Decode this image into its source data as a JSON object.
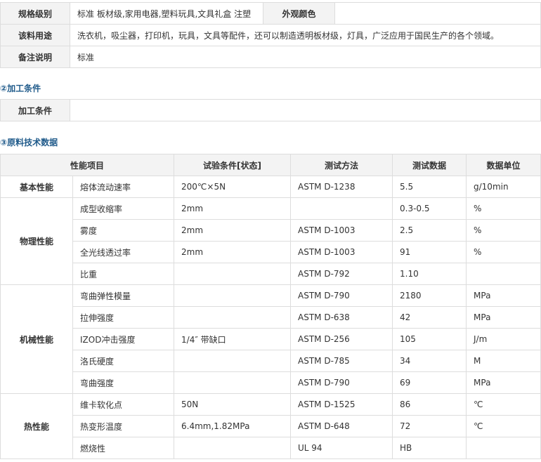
{
  "spec": {
    "rows": [
      {
        "label": "规格级别",
        "value": "标准 板材级,家用电器,塑料玩具,文具礼盒 注塑",
        "label2": "外观颜色",
        "value2": ""
      },
      {
        "label": "该料用途",
        "value": "洗衣机，吸尘器，打印机，玩具，文具等配件，还可以制造透明板材级，灯具，广泛应用于国民生产的各个领域。"
      },
      {
        "label": "备注说明",
        "value": "标准"
      }
    ]
  },
  "processing": {
    "title": "②加工条件",
    "label": "加工条件",
    "value": ""
  },
  "technical": {
    "title": "③原料技术数据",
    "headers": [
      "性能项目",
      "试验条件[状态]",
      "测试方法",
      "测试数据",
      "数据单位"
    ],
    "groups": [
      {
        "name": "基本性能",
        "rows": [
          {
            "item": "熔体流动速率",
            "cond": "200℃×5N",
            "method": "ASTM D-1238",
            "value": "5.5",
            "unit": "g/10min"
          }
        ]
      },
      {
        "name": "物理性能",
        "rows": [
          {
            "item": "成型收缩率",
            "cond": "2mm",
            "method": "",
            "value": "0.3-0.5",
            "unit": "%"
          },
          {
            "item": "雾度",
            "cond": "2mm",
            "method": "ASTM D-1003",
            "value": "2.5",
            "unit": "%"
          },
          {
            "item": "全光线透过率",
            "cond": "2mm",
            "method": "ASTM D-1003",
            "value": "91",
            "unit": "%"
          },
          {
            "item": "比重",
            "cond": "",
            "method": "ASTM D-792",
            "value": "1.10",
            "unit": ""
          }
        ]
      },
      {
        "name": "机械性能",
        "rows": [
          {
            "item": "弯曲弹性模量",
            "cond": "",
            "method": "ASTM D-790",
            "value": "2180",
            "unit": "MPa"
          },
          {
            "item": "拉伸强度",
            "cond": "",
            "method": "ASTM D-638",
            "value": "42",
            "unit": "MPa"
          },
          {
            "item": "IZOD冲击强度",
            "cond": "1/4″ 带缺口",
            "method": "ASTM D-256",
            "value": "105",
            "unit": "J/m"
          },
          {
            "item": "洛氏硬度",
            "cond": "",
            "method": "ASTM D-785",
            "value": "34",
            "unit": "M"
          },
          {
            "item": "弯曲强度",
            "cond": "",
            "method": "ASTM D-790",
            "value": "69",
            "unit": "MPa"
          }
        ]
      },
      {
        "name": "热性能",
        "rows": [
          {
            "item": "维卡软化点",
            "cond": "50N",
            "method": "ASTM D-1525",
            "value": "86",
            "unit": "℃"
          },
          {
            "item": "热变形温度",
            "cond": "6.4mm,1.82MPa",
            "method": "ASTM D-648",
            "value": "72",
            "unit": "℃"
          },
          {
            "item": "燃烧性",
            "cond": "",
            "method": "UL 94",
            "value": "HB",
            "unit": ""
          }
        ]
      }
    ]
  }
}
